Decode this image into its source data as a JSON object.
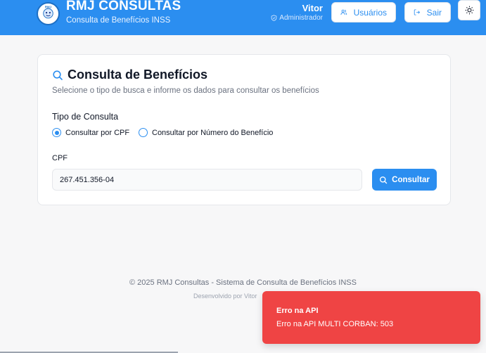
{
  "header": {
    "logo_text": "RMJ",
    "title": "RMJ CONSULTAS",
    "subtitle": "Consulta de Benefícios INSS",
    "user_name": "Vitor",
    "user_role": "Administrador",
    "users_button": "Usuários",
    "exit_button": "Sair",
    "theme_icon": "sun-icon",
    "brand_color": "#2b8ef0"
  },
  "card": {
    "title": "Consulta de Benefícios",
    "subtitle": "Selecione o tipo de busca e informe os dados para consultar os benefícios",
    "type_label": "Tipo de Consulta",
    "options": [
      {
        "label": "Consultar por CPF",
        "selected": true
      },
      {
        "label": "Consultar por Número do Benefício",
        "selected": false
      }
    ],
    "cpf_label": "CPF",
    "cpf_value": "267.451.356-04",
    "submit_button": "Consultar"
  },
  "footer": {
    "copyright": "© 2025 RMJ Consultas - Sistema de Consulta de Benefícios INSS",
    "developer": "Desenvolvido por Vitor"
  },
  "toast": {
    "title": "Erro na API",
    "message": "Erro na API MULTI CORBAN: 503",
    "color": "#ef4444"
  }
}
